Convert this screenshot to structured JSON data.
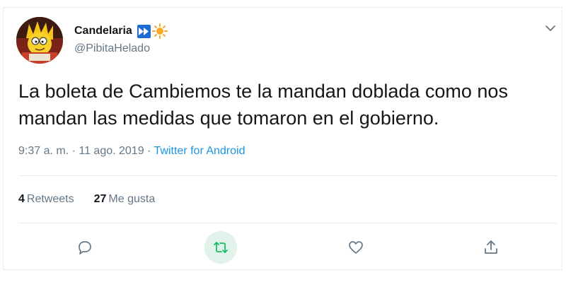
{
  "user": {
    "display_name": "Candelaria",
    "handle": "@PibitaHelado",
    "badge_icons": [
      "fast-forward-icon",
      "sun-icon"
    ],
    "avatar": "cartoon-character-avatar"
  },
  "tweet": {
    "text": "La boleta de Cambiemos te la mandan doblada como nos mandan las medidas que tomaron en el gobierno.",
    "timestamp": "9:37 a. m. · 11 ago. 2019 · ",
    "source": "Twitter for Android"
  },
  "stats": {
    "retweets_count": "4",
    "retweets_label": "Retweets",
    "likes_count": "27",
    "likes_label": "Me gusta"
  },
  "actions": [
    "reply-icon",
    "retweet-icon",
    "like-icon",
    "share-icon"
  ],
  "colors": {
    "link": "#1b95e0",
    "secondary_text": "#657786",
    "retweet_active": "#17bf63",
    "divider": "#e6ecf0"
  }
}
